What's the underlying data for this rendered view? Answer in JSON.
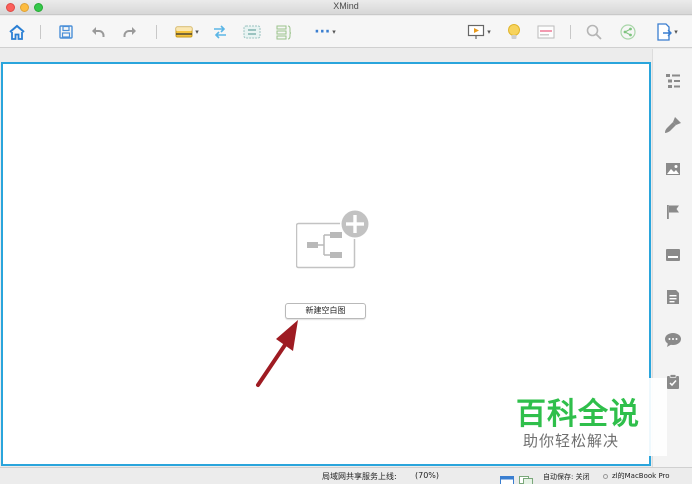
{
  "window": {
    "title": "XMind"
  },
  "toolbar": {
    "items": [
      "home-icon",
      "save-icon",
      "undo-icon",
      "redo-icon",
      "insert-topic-icon",
      "relationship-icon",
      "boundary-icon",
      "summary-icon",
      "more-icon",
      "presentation-icon",
      "idea-icon",
      "outliner-icon",
      "search-icon",
      "share-icon",
      "export-icon"
    ],
    "more_label": "···"
  },
  "sidebar": {
    "items": [
      "outline-icon",
      "format-brush-icon",
      "image-icon",
      "marker-flag-icon",
      "label-icon",
      "notes-icon",
      "comments-icon",
      "task-icon"
    ]
  },
  "main": {
    "new_blank_map_label": "新建空白图"
  },
  "statusbar": {
    "share_label": "局域网共享服务上线:",
    "zoom": "(70%)",
    "autosave": "自动保存: 关闭",
    "user": "zl的MacBook Pro"
  },
  "watermark": {
    "main": "百科全说",
    "sub": "助你轻松解决"
  },
  "colors": {
    "accent": "#2aa5dc",
    "watermark_green": "#2fbf4b",
    "arrow": "#9e1b22"
  }
}
